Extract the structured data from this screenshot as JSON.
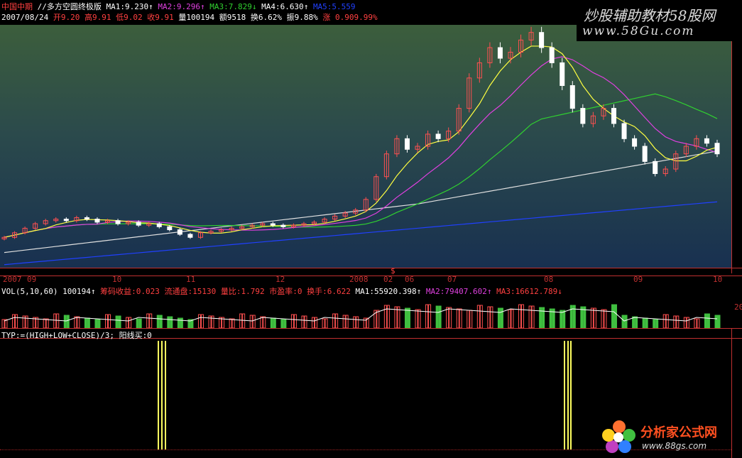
{
  "header": {
    "stock_name": "中国中期",
    "formula_name": "//多方空圆终极版",
    "ma1": "MA1:9.230",
    "ma2": "MA2:9.296",
    "ma3": "MA3:7.829",
    "ma4": "MA4:6.630",
    "ma5": "MA5:5.559",
    "date": "2007/08/24",
    "open": "开9.20",
    "high": "高9.91",
    "low": "低9.02",
    "close": "收9.91",
    "volume": "量100194",
    "amount": "额9518",
    "turnover": "换6.62%",
    "amplitude": "振9.88%",
    "change": "涨 0.90",
    "change_pct": "9.99%"
  },
  "watermark_top": {
    "line1": "炒股辅助教材58股网",
    "line2": "www.58Gu.com"
  },
  "watermark_bottom": {
    "line1": "分析家公式网",
    "line2": "www.88gs.com"
  },
  "xaxis": {
    "labels": [
      "2007",
      "09",
      "10",
      "11",
      "12",
      "2008",
      "02",
      "06",
      "07",
      "08",
      "09",
      "10"
    ],
    "marker": "$"
  },
  "vol_panel": {
    "params": "VOL(5,10,60)",
    "vol": "100194",
    "label1": "筹码收益:0.023",
    "label2": "流通盘:15130",
    "label3": "量比:1.792",
    "label4": "市盈率:0",
    "label5": "换手:6.622",
    "ma1": "MA1:55920.398",
    "ma2": "MA2:79407.602",
    "ma3": "MA3:16612.789",
    "axis_label": "20"
  },
  "ind_panel": {
    "formula": "TYP:=(HIGH+LOW+CLOSE)/3; 阳线买:0"
  },
  "chart_data": {
    "type": "line",
    "note_series": [
      "MA1",
      "MA2",
      "MA3",
      "MA4",
      "MA5"
    ],
    "colors": {
      "up": "#ff5050",
      "down": "#ffffff",
      "ma1": "#ffff40",
      "ma2": "#e040e0",
      "ma3": "#30d030",
      "ma4": "#e0e0e0",
      "ma5": "#2040ff",
      "signal": "#ffff60"
    },
    "closes": [
      5.0,
      5.3,
      5.6,
      5.9,
      6.1,
      6.2,
      6.1,
      6.3,
      6.2,
      6.0,
      6.1,
      5.9,
      6.0,
      5.8,
      5.9,
      5.7,
      5.5,
      5.2,
      5.0,
      5.3,
      5.4,
      5.5,
      5.6,
      5.7,
      5.8,
      5.9,
      5.8,
      5.7,
      5.8,
      5.9,
      6.0,
      6.2,
      6.4,
      6.6,
      6.8,
      7.5,
      9.0,
      10.5,
      11.5,
      10.8,
      11.0,
      11.8,
      11.5,
      12.0,
      13.5,
      15.5,
      16.5,
      17.5,
      16.8,
      17.2,
      18.0,
      18.5,
      17.5,
      16.5,
      15.0,
      13.5,
      12.5,
      13.0,
      13.5,
      12.5,
      11.5,
      11.0,
      10.0,
      9.2,
      9.5,
      10.5,
      11.0,
      11.5,
      11.2,
      10.5
    ],
    "signals": [
      22,
      23,
      80,
      81
    ]
  }
}
